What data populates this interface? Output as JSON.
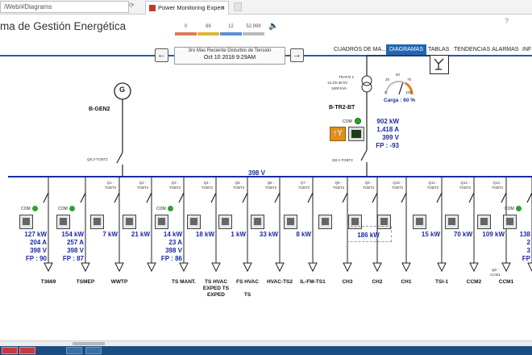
{
  "browser": {
    "url": "/Web/#Diagrams",
    "tab_title": "Power Monitoring Expert",
    "tab_close": "×"
  },
  "app": {
    "title": "ma de Gestión Energética",
    "counters": [
      {
        "value": "0",
        "color": "#e07b5a"
      },
      {
        "value": "66",
        "color": "#e0b43a"
      },
      {
        "value": "12",
        "color": "#5b8fd6"
      },
      {
        "value": "52.999",
        "color": "#bbbbbb"
      }
    ],
    "help": "?"
  },
  "nav": {
    "items": [
      "CUADROS DE MA...",
      "DIAGRAMAS",
      "TABLAS",
      "TENDENCIAS",
      "ALARMAS",
      "INF"
    ],
    "active": "DIAGRAMAS"
  },
  "diagram": {
    "disturbance_title": "3ro Mas Reciente Disturbio de Tensión",
    "disturbance_date": "Oct 10 2018 9:29AM",
    "prev_arrow": "←",
    "next_arrow": "→",
    "gen_label": "B-GEN2",
    "gen_symbol": "G",
    "gen_breaker": "Q8.2-TGBT2",
    "trafo_text": [
      "TRAFO 2",
      "13.2/0.38 kV",
      "1600 kVA"
    ],
    "tr_label": "B-TR2-BT",
    "tr_breaker": "Q8.1-TGBT2",
    "gauge": {
      "ticks": [
        "25",
        "50",
        "75",
        "0",
        "100"
      ],
      "load_pct": 60,
      "load_text": "Carga : 60 %"
    },
    "tr_com": "COM",
    "tr_readings": [
      "902 kW",
      "1,418 A",
      "399 V",
      "FP : -93"
    ],
    "bus_voltage": "398 V",
    "feeders": [
      {
        "breaker": "",
        "com": "COM",
        "readings": [
          "127 kW",
          "204 A",
          "398 V",
          "FP : 90"
        ],
        "name": "T3669"
      },
      {
        "breaker": "",
        "com": "COM",
        "readings": [
          "154 kW",
          "257 A",
          "398 V",
          "FP : 87"
        ],
        "name": "TSMEP"
      },
      {
        "breaker": "Q1 -\nTGBT2",
        "readings": [
          "7 kW"
        ],
        "name": "WWTP"
      },
      {
        "breaker": "Q2 -\nTGBT2",
        "readings": [
          "21 kW"
        ],
        "name": ""
      },
      {
        "breaker": "Q3 -\nTGBT2",
        "com": "COM",
        "readings": [
          "14 kW",
          "23 A",
          "398 V",
          "FP : 86"
        ],
        "name": "TS MANT."
      },
      {
        "breaker": "Q4 -\nTGBT2",
        "readings": [
          "18 kW"
        ],
        "name": "TS HVAC\nEXPED TS\nEXPED"
      },
      {
        "breaker": "Q5 -\nTGBT2",
        "readings": [
          "1 kW"
        ],
        "name": "FS HVAC\n\nTS"
      },
      {
        "breaker": "Q6 -\nTGBT2",
        "readings": [
          "33 kW"
        ],
        "name": "HVAC-TS2"
      },
      {
        "breaker": "Q7 -\nTGBT2",
        "readings": [
          "8 kW"
        ],
        "name": "IL-FM-TS1"
      },
      {
        "breaker": "Q8 -\nTGBT2",
        "name": "CH3"
      },
      {
        "breaker": "Q9 -\nTGBT2",
        "readings": [
          "186 kW"
        ],
        "name": "CH2"
      },
      {
        "breaker": "Q10 -\nTGBT2",
        "name": "CH1"
      },
      {
        "breaker": "Q11 -\nTGBT2",
        "readings": [
          "15 kW"
        ],
        "name": "TSI-1"
      },
      {
        "breaker": "Q12 -\nTGBT2",
        "readings": [
          "70 kW"
        ],
        "name": "CCM2"
      },
      {
        "breaker": "Q13 -\nTGBT2",
        "readings": [
          "109 kW"
        ],
        "name": "CCM1",
        "sub_breaker": "Q8 -\nCCM1"
      },
      {
        "breaker": "",
        "com": "COM",
        "readings": [
          "138",
          "2",
          "3",
          "FP"
        ],
        "name": ""
      }
    ]
  }
}
